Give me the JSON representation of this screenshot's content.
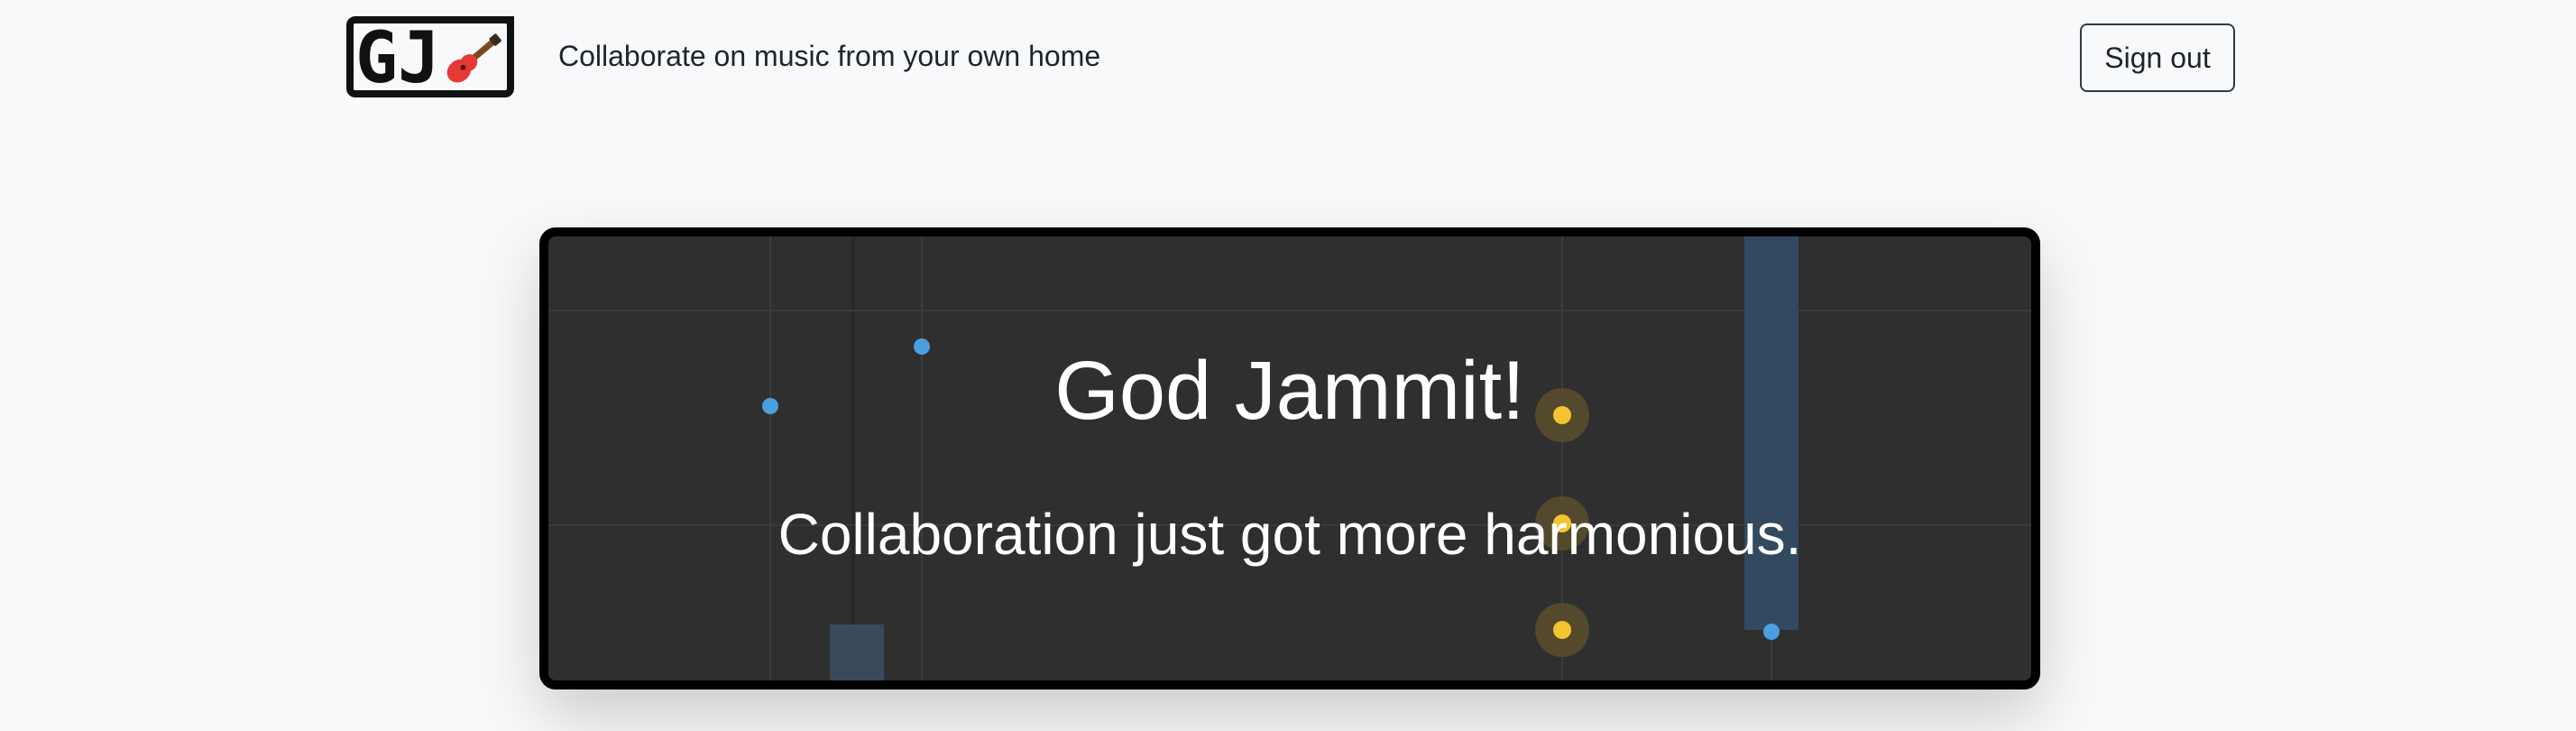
{
  "header": {
    "logo_text": "GJ",
    "tagline": "Collaborate on music from your own home",
    "signout_label": "Sign out"
  },
  "hero": {
    "title": "God Jammit!",
    "subtitle": "Collaboration just got more harmonious."
  },
  "colors": {
    "page_background": "#f8f9fb",
    "hero_background": "#2f2f2f",
    "hero_border": "#000000",
    "note_blue": "#4a9fe0",
    "note_yellow": "#f4c430",
    "text_dark": "#212529",
    "text_light": "#ffffff"
  },
  "icons": {
    "logo_icon": "guitar-icon"
  }
}
